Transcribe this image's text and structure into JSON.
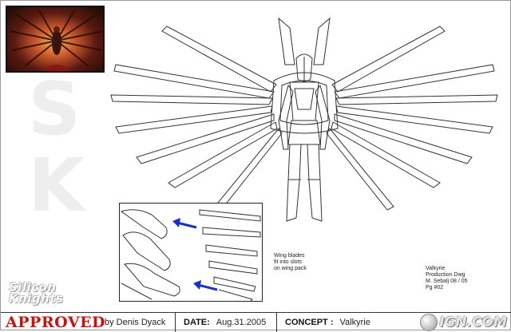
{
  "watermark": {
    "text": "SK"
  },
  "notes": {
    "wing": "Wing blades\nfit into slots\non wing pack",
    "title_block": "Valkyrie\nProduction Dwg\nM. Sebalj 08 / 05\nPg #02"
  },
  "logos": {
    "company": "Silicon\nKnights",
    "site": "IGN.COM"
  },
  "footer": {
    "status": "APPROVED",
    "approver": "by Denis Dyack",
    "date_label": "DATE:",
    "date_value": "Aug.31.2005",
    "concept_label": "CONCEPT :",
    "concept_value": "Valkyrie"
  },
  "colors": {
    "approved_red": "#c8140f",
    "arrow_blue": "#1a2fc9",
    "thumb_orange": "#f3b25a"
  },
  "icons": [
    "blue-arrow-icon",
    "ign-globe-icon"
  ]
}
